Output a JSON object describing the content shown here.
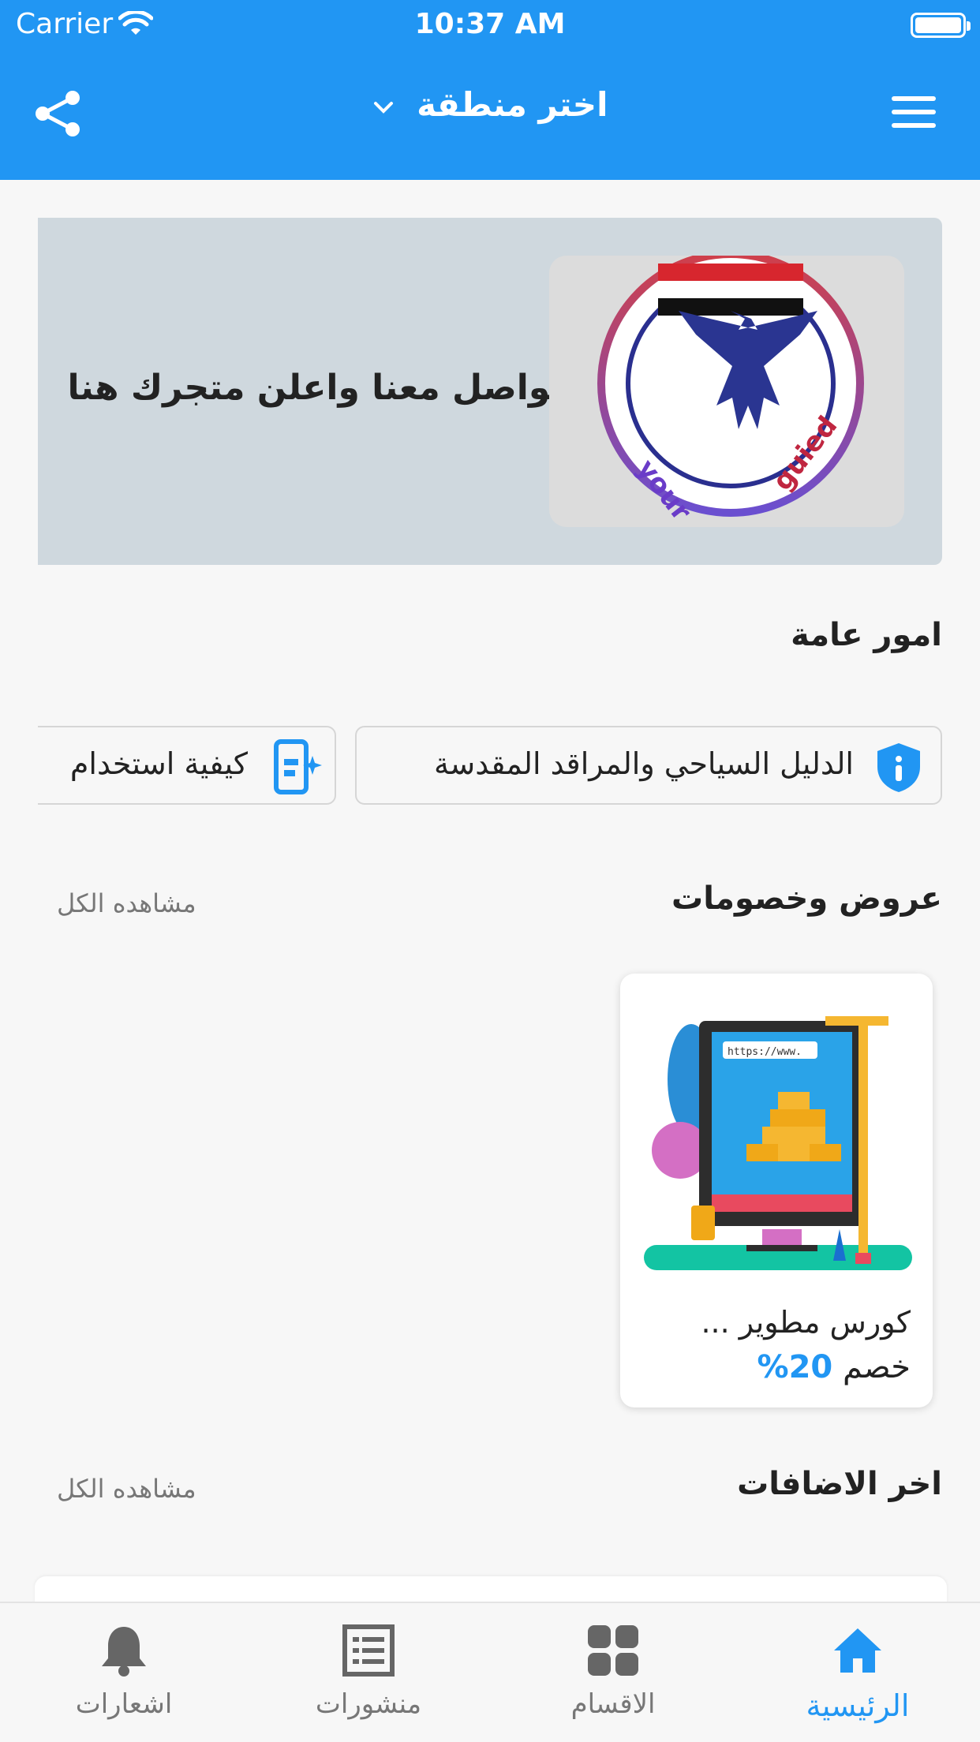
{
  "status_bar": {
    "carrier": "Carrier",
    "time": "10:37 AM"
  },
  "header": {
    "region_label": "اختر منطقة",
    "icons": {
      "share": "share-icon",
      "menu": "menu-icon",
      "dropdown": "chevron-down-icon"
    }
  },
  "banner": {
    "text": "تواصل معنا واعلن متجرك هنا"
  },
  "general": {
    "title": "امور عامة",
    "items": [
      {
        "label": "الدليل السياحي والمراقد المقدسة",
        "icon": "shield-info-icon"
      },
      {
        "label": "كيفية استخدام",
        "icon": "sparkle-phone-icon"
      }
    ]
  },
  "offers": {
    "title": "عروض وخصومات",
    "see_all": "مشاهده الكل",
    "items": [
      {
        "title": "كورس مطوير ...",
        "discount_prefix": "خصم",
        "discount_value": "20%"
      }
    ]
  },
  "latest": {
    "title": "اخر الاضافات",
    "see_all": "مشاهده الكل"
  },
  "bottom_nav": {
    "items": [
      {
        "label": "الرئيسية",
        "icon": "home-icon",
        "active": true
      },
      {
        "label": "الاقسام",
        "icon": "grid-icon",
        "active": false
      },
      {
        "label": "منشورات",
        "icon": "list-icon",
        "active": false
      },
      {
        "label": "اشعارات",
        "icon": "bell-icon",
        "active": false
      }
    ]
  },
  "colors": {
    "primary": "#2196f3",
    "background": "#f7f7f7",
    "banner_bg": "#cfd8de"
  }
}
